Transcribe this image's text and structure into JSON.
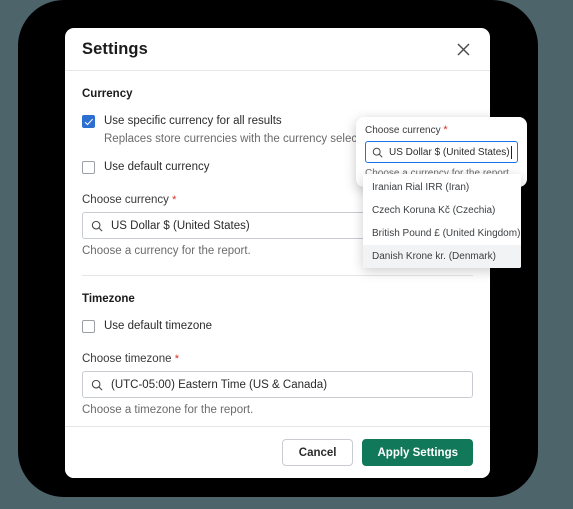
{
  "dialog": {
    "title": "Settings",
    "close_icon": "close-icon"
  },
  "currency_section": {
    "heading": "Currency",
    "use_specific": {
      "label": "Use specific currency for all results",
      "help": "Replaces store currencies with the currency selected here.",
      "checked": true
    },
    "use_default": {
      "label": "Use default currency",
      "checked": false
    },
    "choose_currency": {
      "label": "Choose currency",
      "required_mark": "*",
      "value": "US Dollar $ (United States)",
      "help": "Choose a currency for the report.",
      "search_icon": "search-icon"
    }
  },
  "timezone_section": {
    "heading": "Timezone",
    "use_default": {
      "label": "Use default timezone",
      "checked": false
    },
    "choose_timezone": {
      "label": "Choose timezone",
      "required_mark": "*",
      "value": "(UTC-05:00) Eastern Time (US & Canada)",
      "help": "Choose a timezone for the report.",
      "search_icon": "search-icon"
    }
  },
  "autocomplete": {
    "label": "Choose currency",
    "required_mark": "*",
    "value": "US Dollar $ (United States)",
    "help": "Choose a currency for the report.",
    "search_icon": "search-icon",
    "options": [
      {
        "label": "Iranian Rial IRR (Iran)",
        "active": false
      },
      {
        "label": "Czech Koruna Kč (Czechia)",
        "active": false
      },
      {
        "label": "British Pound £ (United Kingdom)",
        "active": false
      },
      {
        "label": "Danish Krone kr. (Denmark)",
        "active": true
      }
    ]
  },
  "footer": {
    "cancel_label": "Cancel",
    "apply_label": "Apply Settings"
  },
  "colors": {
    "accent_green": "#11785a",
    "checkbox_blue": "#2d6fd1",
    "focus_blue": "#1a73e8",
    "required_red": "#d93025",
    "backdrop": "#4e646b",
    "frame": "#000000"
  }
}
